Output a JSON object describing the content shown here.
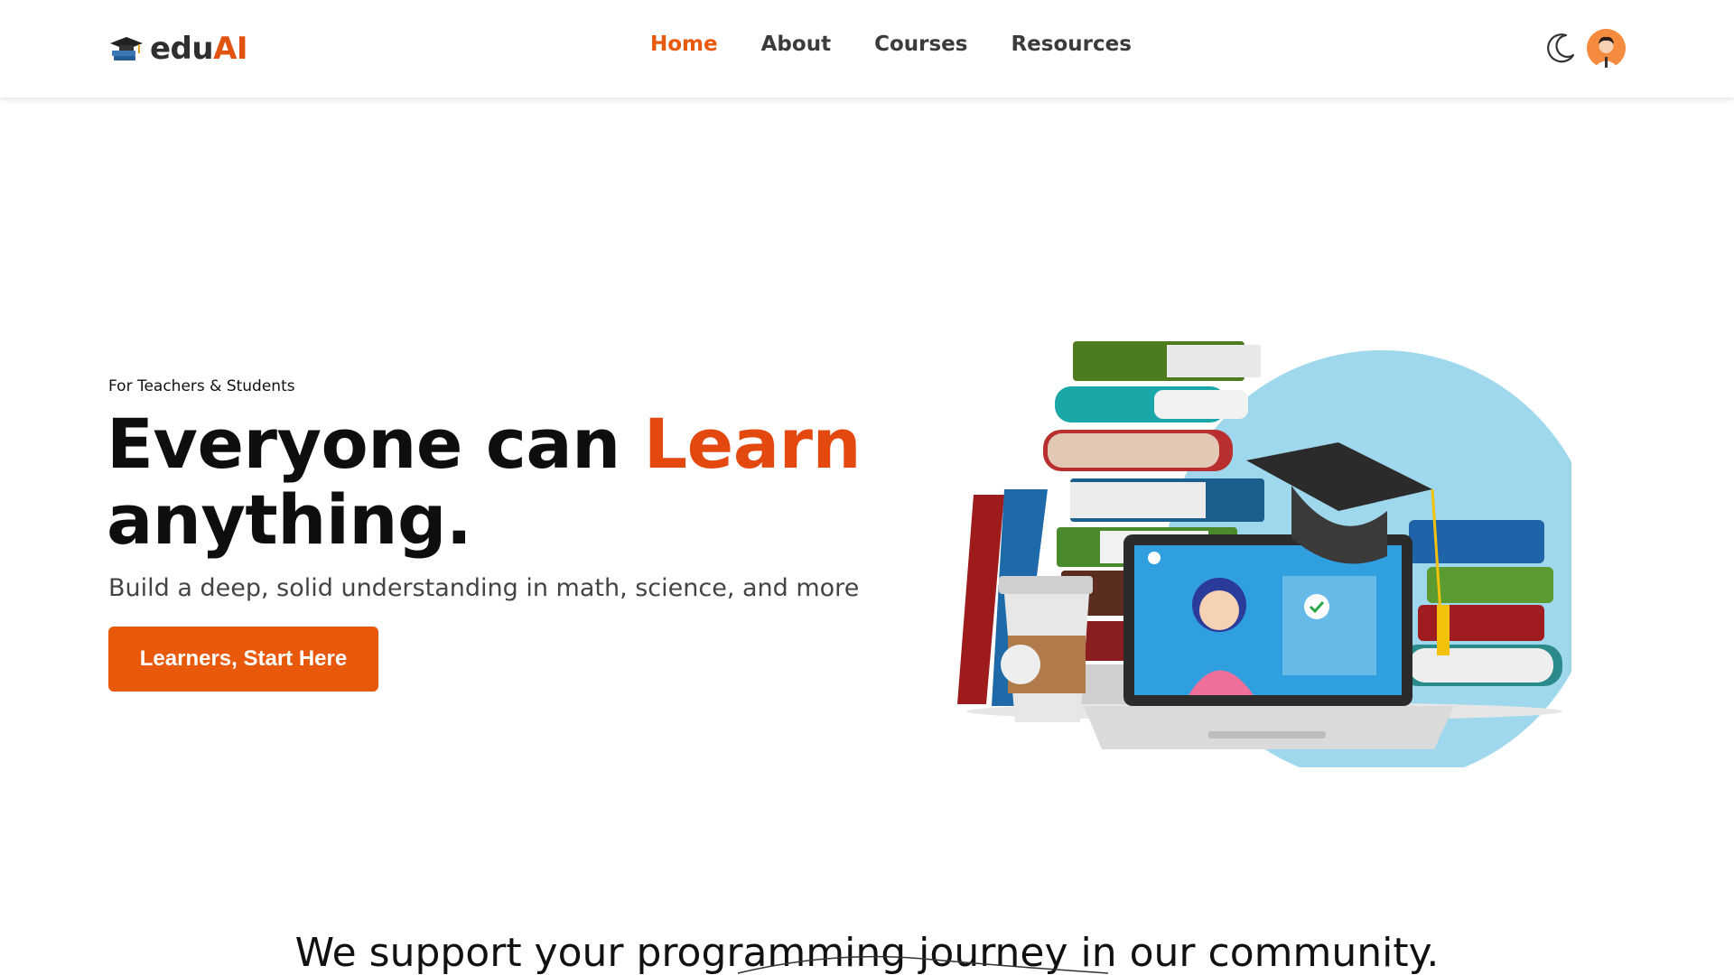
{
  "brand": {
    "prefix": "edu",
    "suffix": "AI",
    "icon": "graduation-cap-books-icon"
  },
  "nav": [
    {
      "label": "Home",
      "active": true
    },
    {
      "label": "About",
      "active": false
    },
    {
      "label": "Courses",
      "active": false
    },
    {
      "label": "Resources",
      "active": false
    }
  ],
  "header_actions": {
    "theme_icon": "moon-icon",
    "avatar_icon": "user-avatar"
  },
  "hero": {
    "eyebrow": "For Teachers & Students",
    "headline_part1": "Everyone can ",
    "headline_highlight": "Learn",
    "headline_part2": "anything.",
    "subtitle": "Build a deep, solid understanding in math, science, and more",
    "cta_label": "Learners, Start Here"
  },
  "section": {
    "tagline": "We support your programming journey in our community."
  },
  "colors": {
    "accent": "#e8590c",
    "headline_highlight": "#e3480f",
    "text": "#111111"
  }
}
